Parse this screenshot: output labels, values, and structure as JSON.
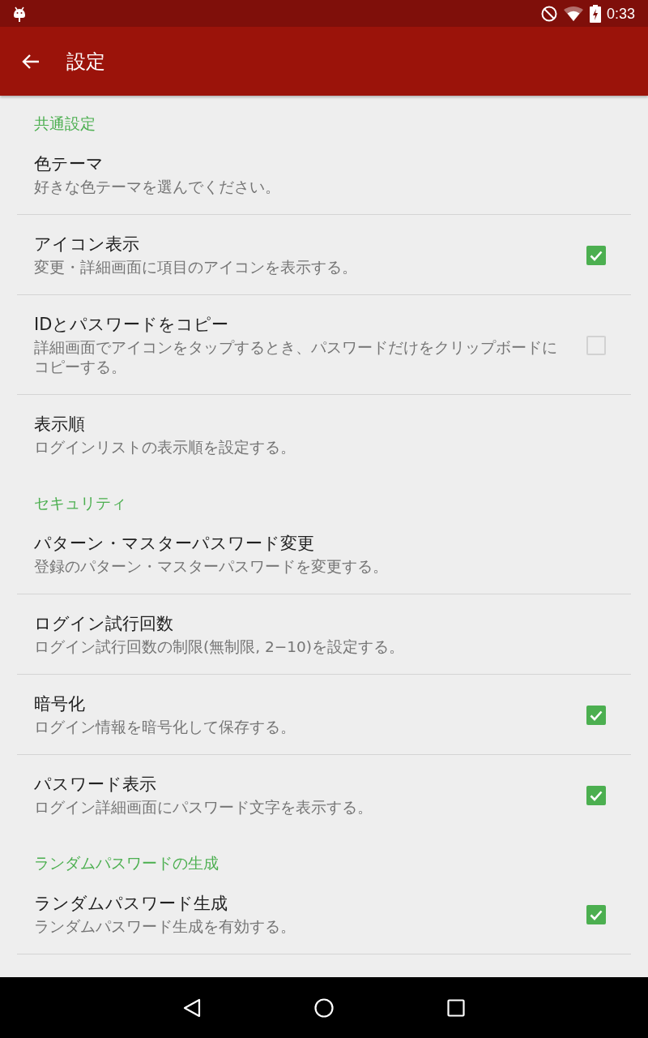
{
  "status_bar": {
    "time": "0:33"
  },
  "app_bar": {
    "title": "設定"
  },
  "sections": [
    {
      "title": "共通設定",
      "items": [
        {
          "kind": "plain",
          "title": "色テーマ",
          "summary": "好きな色テーマを選んでください。",
          "divider_below": true
        },
        {
          "kind": "checkbox",
          "title": "アイコン表示",
          "summary": "変更・詳細画面に項目のアイコンを表示する。",
          "checked": true,
          "divider_below": true
        },
        {
          "kind": "checkbox",
          "title": "IDとパスワードをコピー",
          "summary": "詳細画面でアイコンをタップするとき、パスワードだけをクリップボードにコピーする。",
          "checked": false,
          "divider_below": true
        },
        {
          "kind": "plain",
          "title": "表示順",
          "summary": "ログインリストの表示順を設定する。",
          "divider_below": false
        }
      ]
    },
    {
      "title": "セキュリティ",
      "items": [
        {
          "kind": "plain",
          "title": "パターン・マスターパスワード変更",
          "summary": "登録のパターン・マスターパスワードを変更する。",
          "divider_below": true
        },
        {
          "kind": "plain",
          "title": "ログイン試行回数",
          "summary": "ログイン試行回数の制限(無制限, 2−10)を設定する。",
          "divider_below": true
        },
        {
          "kind": "checkbox",
          "title": "暗号化",
          "summary": "ログイン情報を暗号化して保存する。",
          "checked": true,
          "divider_below": true
        },
        {
          "kind": "checkbox",
          "title": "パスワード表示",
          "summary": "ログイン詳細画面にパスワード文字を表示する。",
          "checked": true,
          "divider_below": false
        }
      ]
    },
    {
      "title": "ランダムパスワードの生成",
      "items": [
        {
          "kind": "checkbox",
          "title": "ランダムパスワード生成",
          "summary": "ランダムパスワード生成を有効する。",
          "checked": true,
          "divider_below": true
        }
      ]
    }
  ]
}
